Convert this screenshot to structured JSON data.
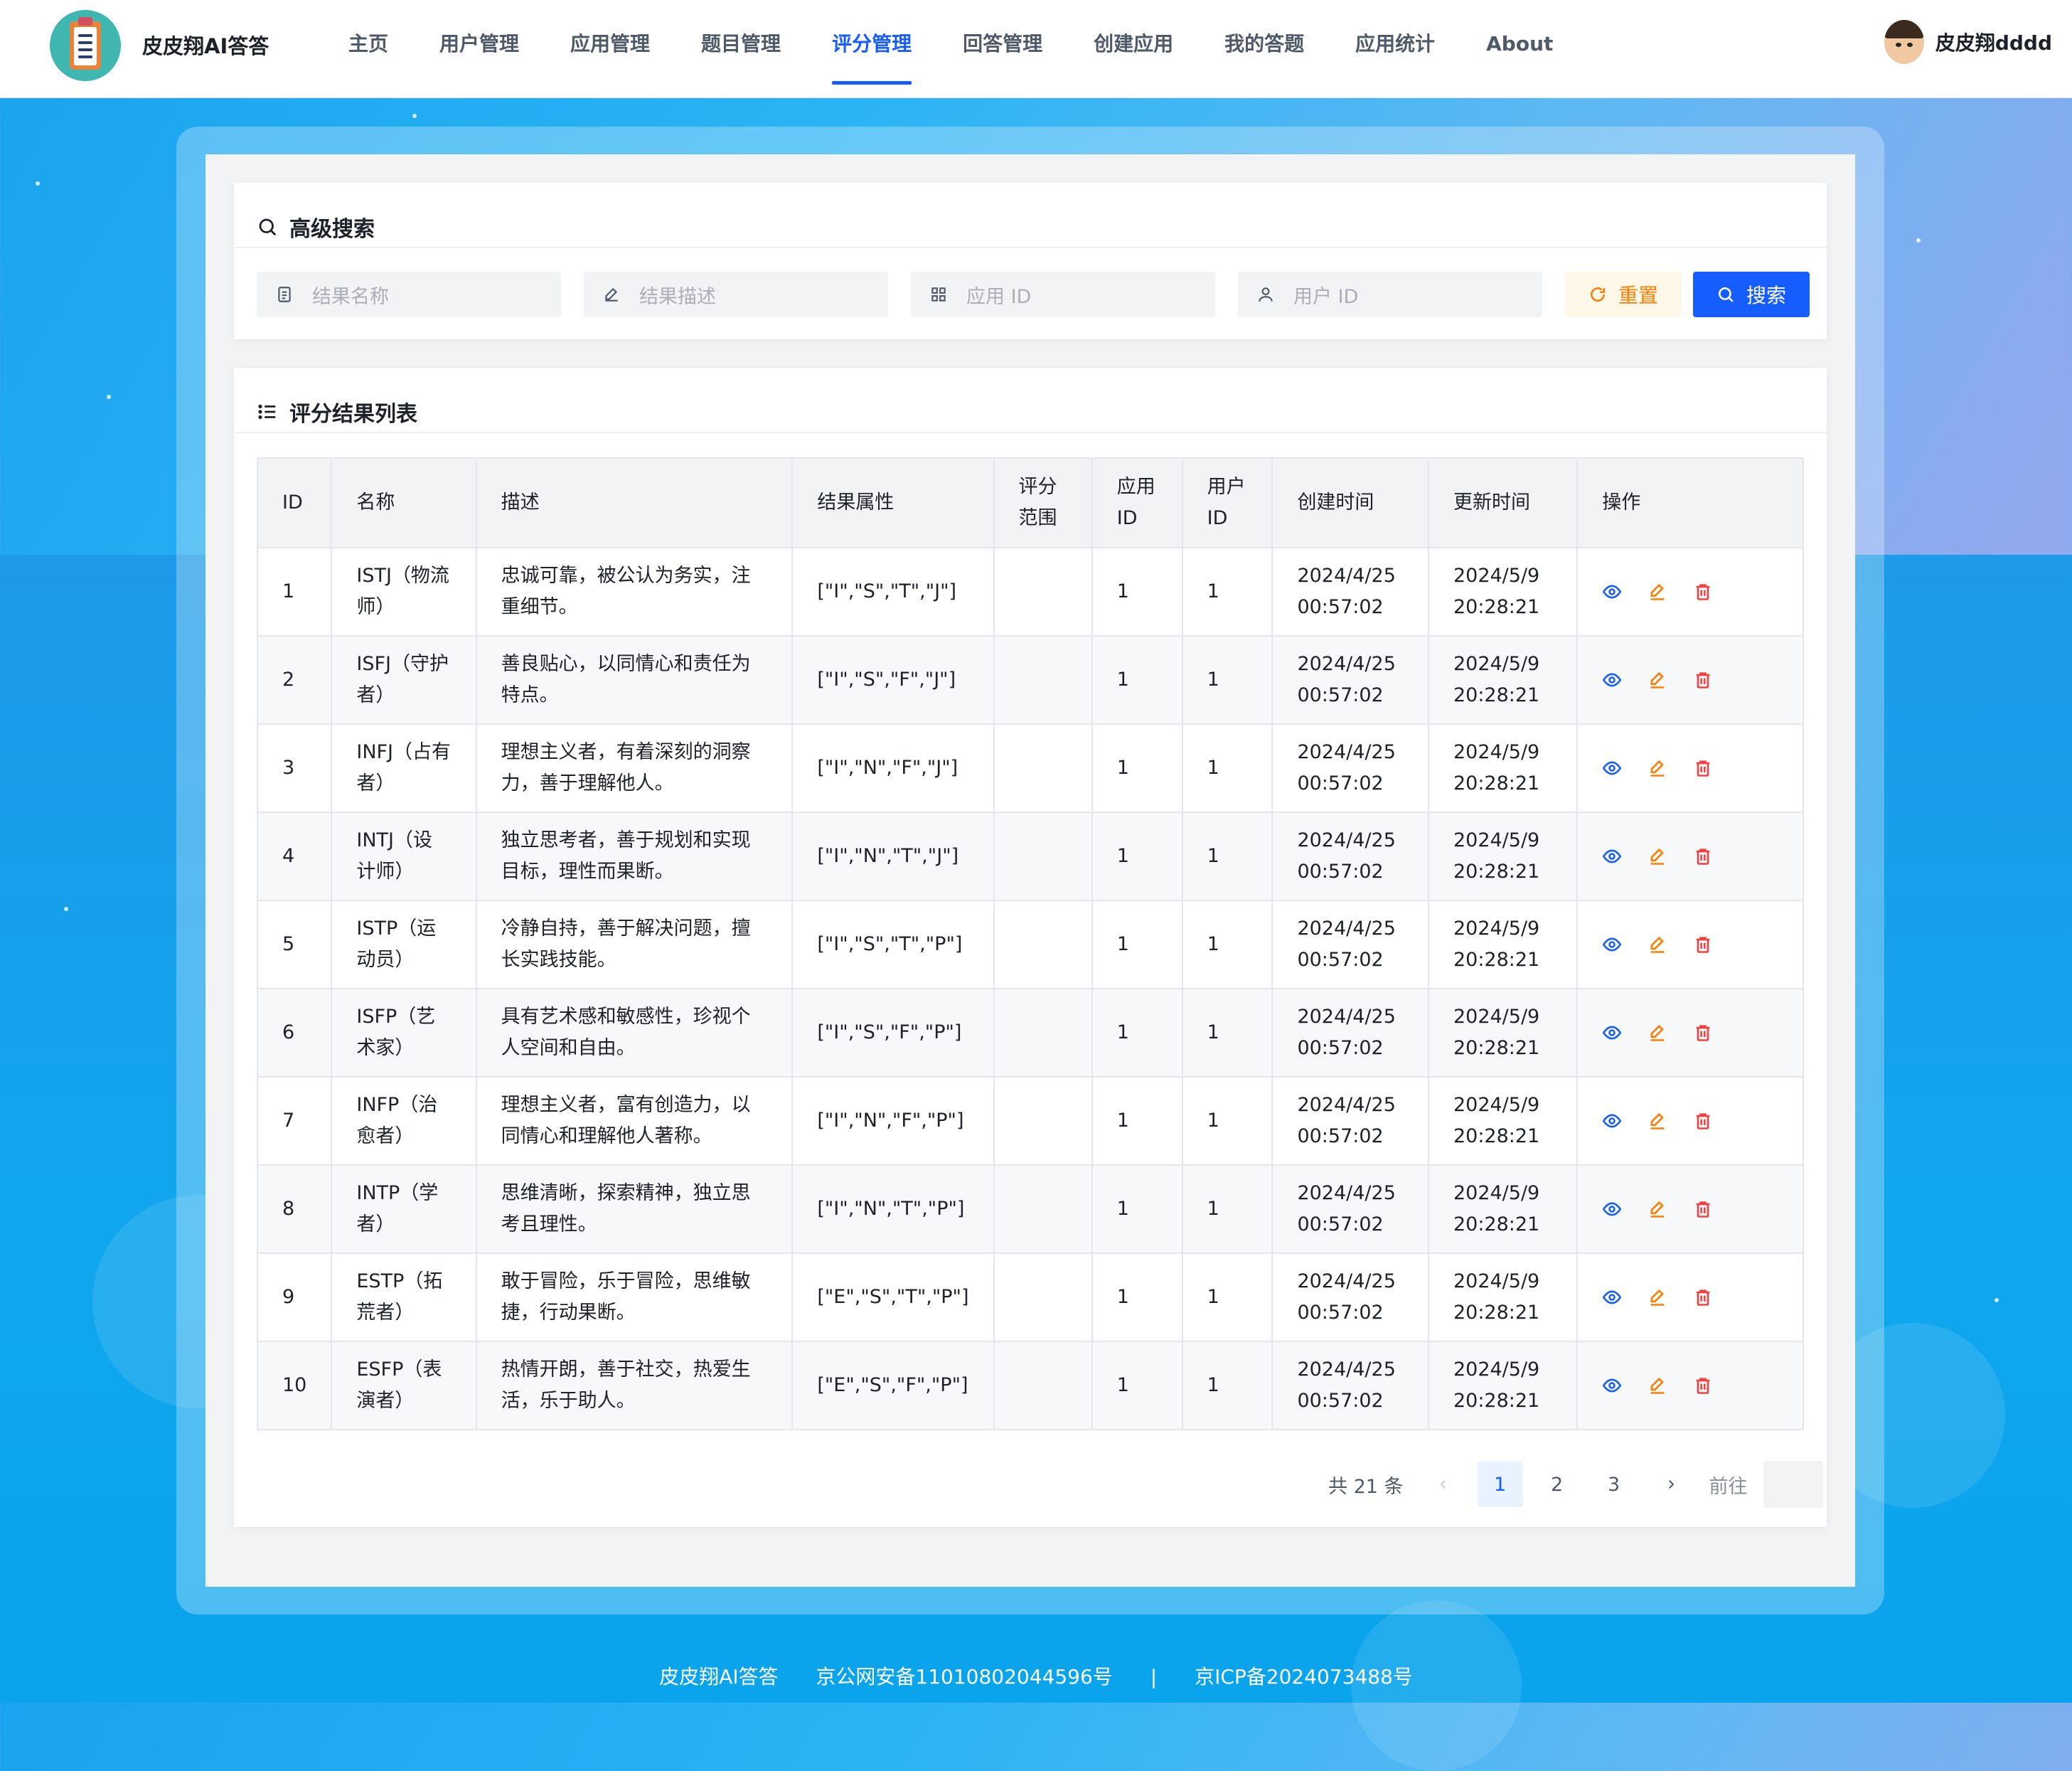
{
  "app": {
    "title": "皮皮翔AI答答"
  },
  "nav": {
    "items": [
      {
        "label": "主页"
      },
      {
        "label": "用户管理"
      },
      {
        "label": "应用管理"
      },
      {
        "label": "题目管理"
      },
      {
        "label": "评分管理",
        "active": true
      },
      {
        "label": "回答管理"
      },
      {
        "label": "创建应用"
      },
      {
        "label": "我的答题"
      },
      {
        "label": "应用统计"
      },
      {
        "label": "About"
      }
    ]
  },
  "user": {
    "name": "皮皮翔dddd"
  },
  "search": {
    "title": "高级搜索",
    "fields": {
      "result_name": {
        "placeholder": "结果名称",
        "value": ""
      },
      "result_desc": {
        "placeholder": "结果描述",
        "value": ""
      },
      "app_id": {
        "placeholder": "应用 ID",
        "value": ""
      },
      "user_id": {
        "placeholder": "用户 ID",
        "value": ""
      }
    },
    "reset_label": "重置",
    "search_label": "搜索"
  },
  "list": {
    "title": "评分结果列表",
    "columns": [
      "ID",
      "名称",
      "描述",
      "结果属性",
      "评分范围",
      "应用ID",
      "用户ID",
      "创建时间",
      "更新时间",
      "操作"
    ],
    "rows": [
      {
        "id": "1",
        "name": "ISTJ（物流师）",
        "desc": "忠诚可靠，被公认为务实，注重细节。",
        "prop": "[\"I\",\"S\",\"T\",\"J\"]",
        "range": "",
        "app_id": "1",
        "user_id": "1",
        "created": "2024/4/25 00:57:02",
        "updated": "2024/5/9 20:28:21"
      },
      {
        "id": "2",
        "name": "ISFJ（守护者）",
        "desc": "善良贴心，以同情心和责任为特点。",
        "prop": "[\"I\",\"S\",\"F\",\"J\"]",
        "range": "",
        "app_id": "1",
        "user_id": "1",
        "created": "2024/4/25 00:57:02",
        "updated": "2024/5/9 20:28:21"
      },
      {
        "id": "3",
        "name": "INFJ（占有者）",
        "desc": "理想主义者，有着深刻的洞察力，善于理解他人。",
        "prop": "[\"I\",\"N\",\"F\",\"J\"]",
        "range": "",
        "app_id": "1",
        "user_id": "1",
        "created": "2024/4/25 00:57:02",
        "updated": "2024/5/9 20:28:21"
      },
      {
        "id": "4",
        "name": "INTJ（设计师）",
        "desc": "独立思考者，善于规划和实现目标，理性而果断。",
        "prop": "[\"I\",\"N\",\"T\",\"J\"]",
        "range": "",
        "app_id": "1",
        "user_id": "1",
        "created": "2024/4/25 00:57:02",
        "updated": "2024/5/9 20:28:21"
      },
      {
        "id": "5",
        "name": "ISTP（运动员）",
        "desc": "冷静自持，善于解决问题，擅长实践技能。",
        "prop": "[\"I\",\"S\",\"T\",\"P\"]",
        "range": "",
        "app_id": "1",
        "user_id": "1",
        "created": "2024/4/25 00:57:02",
        "updated": "2024/5/9 20:28:21"
      },
      {
        "id": "6",
        "name": "ISFP（艺术家）",
        "desc": "具有艺术感和敏感性，珍视个人空间和自由。",
        "prop": "[\"I\",\"S\",\"F\",\"P\"]",
        "range": "",
        "app_id": "1",
        "user_id": "1",
        "created": "2024/4/25 00:57:02",
        "updated": "2024/5/9 20:28:21"
      },
      {
        "id": "7",
        "name": "INFP（治愈者）",
        "desc": "理想主义者，富有创造力，以同情心和理解他人著称。",
        "prop": "[\"I\",\"N\",\"F\",\"P\"]",
        "range": "",
        "app_id": "1",
        "user_id": "1",
        "created": "2024/4/25 00:57:02",
        "updated": "2024/5/9 20:28:21"
      },
      {
        "id": "8",
        "name": "INTP（学者）",
        "desc": "思维清晰，探索精神，独立思考且理性。",
        "prop": "[\"I\",\"N\",\"T\",\"P\"]",
        "range": "",
        "app_id": "1",
        "user_id": "1",
        "created": "2024/4/25 00:57:02",
        "updated": "2024/5/9 20:28:21"
      },
      {
        "id": "9",
        "name": "ESTP（拓荒者）",
        "desc": "敢于冒险，乐于冒险，思维敏捷，行动果断。",
        "prop": "[\"E\",\"S\",\"T\",\"P\"]",
        "range": "",
        "app_id": "1",
        "user_id": "1",
        "created": "2024/4/25 00:57:02",
        "updated": "2024/5/9 20:28:21"
      },
      {
        "id": "10",
        "name": "ESFP（表演者）",
        "desc": "热情开朗，善于社交，热爱生活，乐于助人。",
        "prop": "[\"E\",\"S\",\"F\",\"P\"]",
        "range": "",
        "app_id": "1",
        "user_id": "1",
        "created": "2024/4/25 00:57:02",
        "updated": "2024/5/9 20:28:21"
      }
    ]
  },
  "pagination": {
    "total_label": "共 21 条",
    "pages": [
      "1",
      "2",
      "3"
    ],
    "current": "1",
    "goto_label": "前往"
  },
  "footer": {
    "site": "皮皮翔AI答答",
    "police": "京公网安备11010802044596号",
    "sep": "|",
    "icp": "京ICP备2024073488号"
  },
  "colors": {
    "primary": "#165dff",
    "warning": "#ff7d00",
    "danger": "#f53f3f"
  }
}
